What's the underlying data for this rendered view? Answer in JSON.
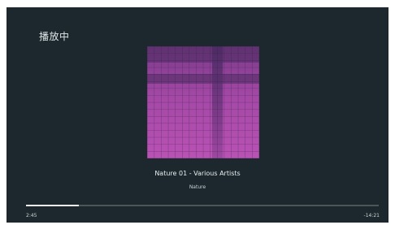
{
  "header": {
    "title": "播放中"
  },
  "now_playing": {
    "track_line": "Nature 01 - Various Artists",
    "album": "Nature",
    "elapsed": "2:45",
    "remaining": "-14:21",
    "progress": 0.15
  },
  "colors": {
    "background": "#1c282d",
    "art_base": "#b34fb0",
    "art_dark": "#7a3a86",
    "progress_track": "#4b5659",
    "progress_fill": "#f1f5f6"
  },
  "icons": {
    "album_art": "album-art-mosaic"
  }
}
